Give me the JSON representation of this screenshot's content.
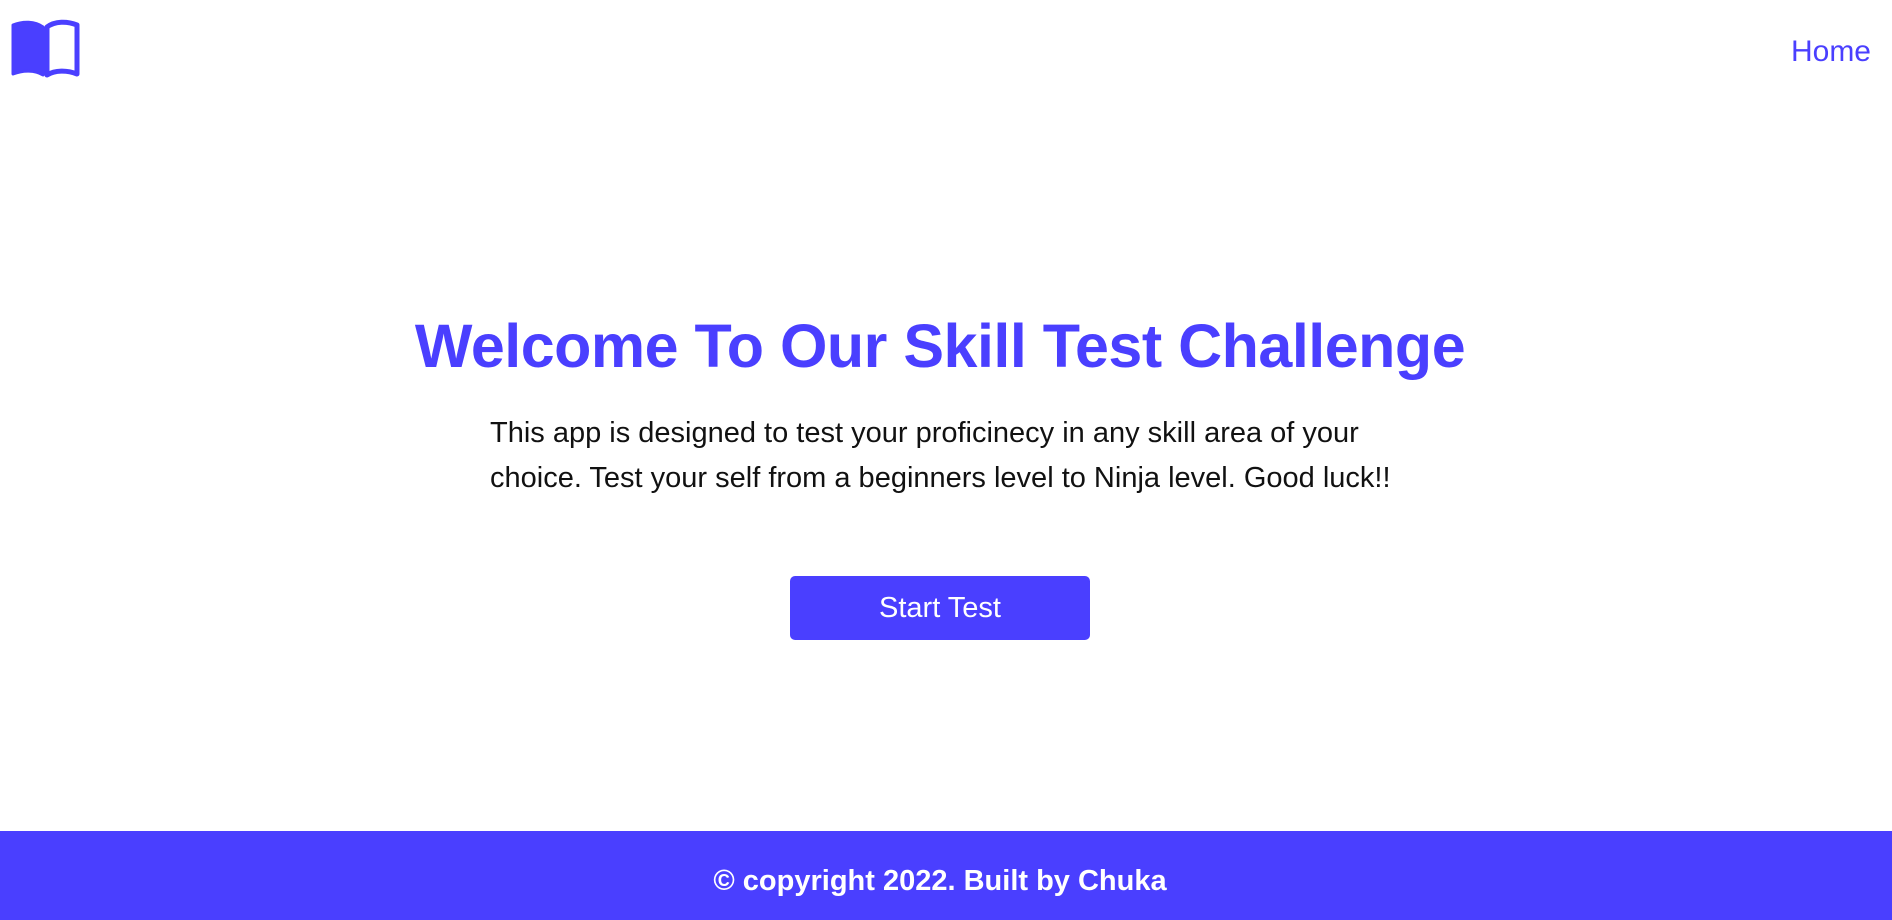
{
  "header": {
    "logo_icon": "open-book-icon",
    "nav": {
      "home_label": "Home"
    }
  },
  "hero": {
    "title": "Welcome To Our Skill Test Challenge",
    "description": "This app is designed to test your proficinecy in any skill area of your choice. Test your self from a beginners level to Ninja level. Good luck!!",
    "start_button_label": "Start Test"
  },
  "footer": {
    "text": "© copyright 2022. Built by Chuka"
  },
  "colors": {
    "accent": "#4a3fff",
    "background": "#ffffff",
    "body_text": "#111111",
    "footer_text": "#ffffff"
  }
}
